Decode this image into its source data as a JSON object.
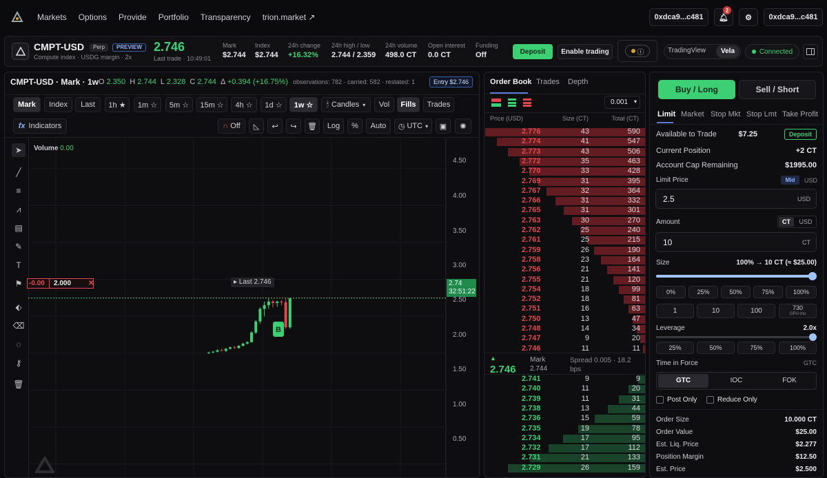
{
  "nav": {
    "items": [
      "Markets",
      "Options",
      "Provide",
      "Portfolio",
      "Transparency",
      "trion.market ↗"
    ],
    "wallet1": "0xdca9...c481",
    "wallet2": "0xdca9...c481",
    "notif_count": "2"
  },
  "header": {
    "symbol": "CMPT-USD",
    "perp": "Perp",
    "preview": "PREVIEW",
    "sub": "Compute index · USDG margin · 2x",
    "price": "2.746",
    "last_trade": "Last trade · 10:49:01",
    "stats": [
      {
        "label": "Mark",
        "value": "$2.744"
      },
      {
        "label": "Index",
        "value": "$2.744"
      },
      {
        "label": "24h change",
        "value": "+16.32%"
      },
      {
        "label": "24h high / low",
        "value": "2.744 / 2.359"
      },
      {
        "label": "24h volume",
        "value": "498.0 CT"
      },
      {
        "label": "Open interest",
        "value": "0.0 CT"
      },
      {
        "label": "Funding",
        "value": "Off"
      }
    ],
    "deposit": "Deposit",
    "enable": "Enable trading",
    "tv": "TradingView",
    "vela": "Vela",
    "connected": "Connected"
  },
  "chart": {
    "title": "CMPT-USD · Mark · 1w",
    "o": "2.350",
    "h": "2.744",
    "l": "2.328",
    "c": "2.744",
    "delta": "+0.394 (+16.75%)",
    "obs": "observations: 782 · carried: 582 · restated: 1",
    "entry": "Entry $2.746",
    "src": [
      "Mark",
      "Index",
      "Last"
    ],
    "tfs": [
      "1h ★",
      "1m ☆",
      "5m ☆",
      "15m ☆",
      "4h ☆",
      "1d ☆",
      "1w ☆"
    ],
    "candles": "Candles",
    "vol": "Vol",
    "fills": "Fills",
    "trades": "Trades",
    "indicators": "Indicators",
    "off": "Off",
    "log": "Log",
    "pct": "%",
    "auto": "Auto",
    "utc": "UTC",
    "volume_label": "Volume",
    "volume_value": "0.00",
    "last_label": "Last 2.746",
    "price_tag": "2.74",
    "countdown": "32:51:22",
    "order_neg": "-0.00",
    "order_qty": "2.000",
    "fill_marker": "B",
    "yticks": [
      "4.50",
      "4.00",
      "3.50",
      "3.00",
      "2.50",
      "2.00",
      "1.50",
      "1.00",
      "0.50"
    ]
  },
  "chart_data": {
    "type": "candlestick",
    "ylim": [
      0.3,
      4.75
    ],
    "last": 2.746,
    "candles": [
      [
        2.0,
        2.02,
        1.99,
        2.01
      ],
      [
        2.01,
        2.03,
        2.0,
        2.02
      ],
      [
        2.02,
        2.05,
        2.01,
        2.04
      ],
      [
        2.04,
        2.06,
        2.03,
        2.03
      ],
      [
        2.03,
        2.07,
        2.02,
        2.06
      ],
      [
        2.06,
        2.09,
        2.05,
        2.08
      ],
      [
        2.08,
        2.1,
        2.06,
        2.07
      ],
      [
        2.07,
        2.11,
        2.06,
        2.1
      ],
      [
        2.1,
        2.14,
        2.09,
        2.13
      ],
      [
        2.13,
        2.16,
        2.12,
        2.15
      ],
      [
        2.15,
        2.3,
        2.14,
        2.28
      ],
      [
        2.28,
        2.45,
        2.26,
        2.43
      ],
      [
        2.43,
        2.62,
        2.4,
        2.6
      ],
      [
        2.6,
        2.7,
        2.5,
        2.65
      ],
      [
        2.65,
        2.74,
        2.6,
        2.7
      ],
      [
        2.7,
        2.72,
        2.62,
        2.68
      ],
      [
        2.68,
        2.71,
        2.63,
        2.7
      ],
      [
        2.7,
        2.72,
        2.65,
        2.69
      ],
      [
        2.69,
        2.74,
        2.33,
        2.35
      ],
      [
        2.35,
        2.744,
        2.33,
        2.744
      ]
    ]
  },
  "orderbook": {
    "tabs": [
      "Order Book",
      "Trades",
      "Depth"
    ],
    "tick": "0.001",
    "cols": [
      "Price (USD)",
      "Size (CT)",
      "Total (CT)"
    ],
    "asks": [
      [
        "2.776",
        "43",
        "590"
      ],
      [
        "2.774",
        "41",
        "547"
      ],
      [
        "2.773",
        "43",
        "506"
      ],
      [
        "2.772",
        "35",
        "463"
      ],
      [
        "2.770",
        "33",
        "428"
      ],
      [
        "2.769",
        "31",
        "395"
      ],
      [
        "2.767",
        "32",
        "364"
      ],
      [
        "2.766",
        "31",
        "332"
      ],
      [
        "2.765",
        "31",
        "301"
      ],
      [
        "2.763",
        "30",
        "270"
      ],
      [
        "2.762",
        "25",
        "240"
      ],
      [
        "2.761",
        "25",
        "215"
      ],
      [
        "2.759",
        "26",
        "190"
      ],
      [
        "2.758",
        "23",
        "164"
      ],
      [
        "2.756",
        "21",
        "141"
      ],
      [
        "2.755",
        "21",
        "120"
      ],
      [
        "2.754",
        "18",
        "99"
      ],
      [
        "2.752",
        "18",
        "81"
      ],
      [
        "2.751",
        "16",
        "63"
      ],
      [
        "2.750",
        "13",
        "47"
      ],
      [
        "2.748",
        "14",
        "34"
      ],
      [
        "2.747",
        "9",
        "20"
      ],
      [
        "2.746",
        "11",
        "11"
      ]
    ],
    "mid": "2.746",
    "mark_label": "Mark",
    "mark_value": "2.744",
    "spread": "Spread 0.005 · 18.2 bps",
    "bids": [
      [
        "2.741",
        "9",
        "9"
      ],
      [
        "2.740",
        "11",
        "20"
      ],
      [
        "2.739",
        "11",
        "31"
      ],
      [
        "2.738",
        "13",
        "44"
      ],
      [
        "2.736",
        "15",
        "59"
      ],
      [
        "2.735",
        "19",
        "78"
      ],
      [
        "2.734",
        "17",
        "95"
      ],
      [
        "2.732",
        "17",
        "112"
      ],
      [
        "2.731",
        "21",
        "133"
      ],
      [
        "2.729",
        "26",
        "159"
      ]
    ]
  },
  "order": {
    "buy": "Buy / Long",
    "sell": "Sell / Short",
    "types": [
      "Limit",
      "Market",
      "Stop Mkt",
      "Stop Lmt",
      "Take Profit"
    ],
    "avail_label": "Available to Trade",
    "avail_value": "$7.25",
    "deposit": "Deposit",
    "pos_label": "Current Position",
    "pos_value": "+2 CT",
    "cap_label": "Account Cap Remaining",
    "cap_value": "$1995.00",
    "limit_label": "Limit Price",
    "mid": "Mid",
    "usd": "USD",
    "limit_value": "2.5",
    "limit_unit": "USD",
    "amount_label": "Amount",
    "ct": "CT",
    "amount_value": "10",
    "amount_unit": "CT",
    "size_label": "Size",
    "size_value": "100% → 10 CT (≈ $25.00)",
    "size_pct": 100,
    "pcts": [
      "0%",
      "25%",
      "50%",
      "75%",
      "100%"
    ],
    "qtys": [
      "1",
      "10",
      "100"
    ],
    "gpu_top": "730",
    "gpu_sub": "GPU-mo",
    "lev_label": "Leverage",
    "lev_value": "2.0x",
    "lev_pct": 100,
    "lev_pcts": [
      "25%",
      "50%",
      "75%",
      "100%"
    ],
    "tif_label": "Time in Force",
    "tif_short": "GTC",
    "tifs": [
      "GTC",
      "IOC",
      "FOK"
    ],
    "post_only": "Post Only",
    "reduce_only": "Reduce Only",
    "summary": [
      {
        "label": "Order Size",
        "value": "10.000 CT"
      },
      {
        "label": "Order Value",
        "value": "$25.00"
      },
      {
        "label": "Est. Liq. Price",
        "value": "$2.277"
      },
      {
        "label": "Position Margin",
        "value": "$12.50"
      },
      {
        "label": "Est. Price",
        "value": "$2.500"
      }
    ]
  },
  "colors": {
    "green": "#3ccf73",
    "red": "#e0484d",
    "accent": "#3ccf73",
    "blue_slider": "#9fc3ff"
  }
}
